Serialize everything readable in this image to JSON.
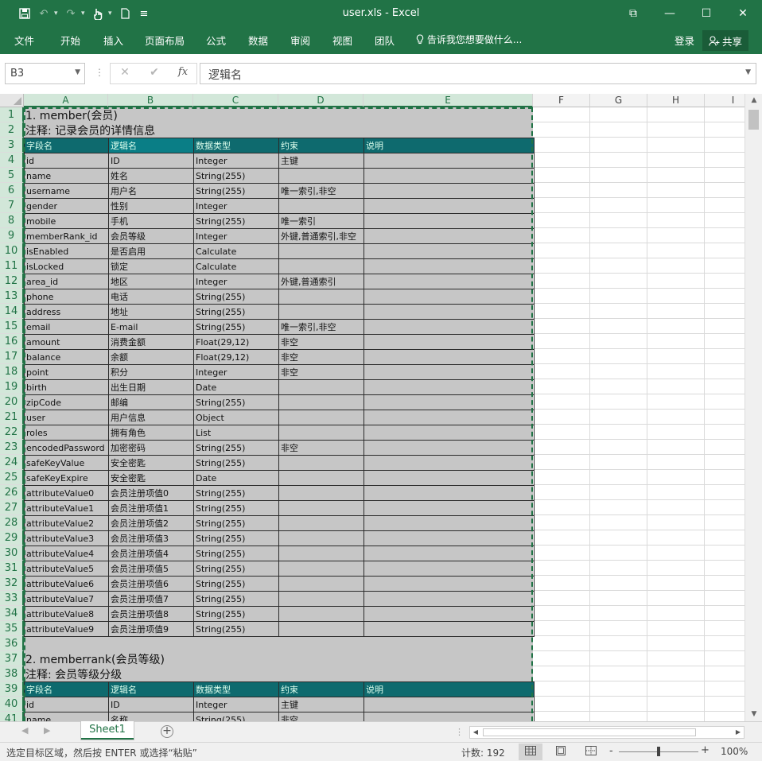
{
  "titlebar": {
    "title": "user.xls - Excel",
    "qat_more": "≡",
    "restore_glyph": "⧉",
    "min_glyph": "—",
    "max_glyph": "☐",
    "close_glyph": "✕"
  },
  "ribbon": {
    "tabs": [
      "文件",
      "开始",
      "插入",
      "页面布局",
      "公式",
      "数据",
      "审阅",
      "视图",
      "团队"
    ],
    "tell_me": "告诉我您想要做什么...",
    "login": "登录",
    "share": "共享"
  },
  "formula_bar": {
    "name_box": "B3",
    "cancel": "✕",
    "enter": "✔",
    "fx": "fx",
    "content": "逻辑名"
  },
  "columns": [
    "A",
    "B",
    "C",
    "D",
    "E",
    "F",
    "G",
    "H",
    "I"
  ],
  "rows": [
    "1",
    "2",
    "3",
    "4",
    "5",
    "6",
    "7",
    "8",
    "9",
    "10",
    "11",
    "12",
    "13",
    "14",
    "15",
    "16",
    "17",
    "18",
    "19",
    "20",
    "21",
    "22",
    "23",
    "24",
    "25",
    "26",
    "27",
    "28",
    "29",
    "30",
    "31",
    "32",
    "33",
    "34",
    "35",
    "36",
    "37",
    "38",
    "39",
    "40",
    "41"
  ],
  "sheet": {
    "section1_title": "1. member(会员)",
    "section1_note": "注释: 记录会员的详情信息",
    "section2_title": "2. memberrank(会员等级)",
    "section2_note": "注释: 会员等级分级",
    "header": [
      "字段名",
      "逻辑名",
      "数据类型",
      "约束",
      "说明"
    ],
    "table1": [
      [
        "id",
        "ID",
        "Integer",
        "主键",
        ""
      ],
      [
        "name",
        "姓名",
        "String(255)",
        "",
        ""
      ],
      [
        "username",
        "用户名",
        "String(255)",
        "唯一索引,非空",
        ""
      ],
      [
        "gender",
        "性别",
        "Integer",
        "",
        ""
      ],
      [
        "mobile",
        "手机",
        "String(255)",
        "唯一索引",
        ""
      ],
      [
        "memberRank_id",
        "会员等级",
        "Integer",
        "外键,普通索引,非空",
        ""
      ],
      [
        "isEnabled",
        "是否启用",
        "Calculate",
        "",
        ""
      ],
      [
        "isLocked",
        "锁定",
        "Calculate",
        "",
        ""
      ],
      [
        "area_id",
        "地区",
        "Integer",
        "外键,普通索引",
        ""
      ],
      [
        "phone",
        "电话",
        "String(255)",
        "",
        ""
      ],
      [
        "address",
        "地址",
        "String(255)",
        "",
        ""
      ],
      [
        "email",
        "E-mail",
        "String(255)",
        "唯一索引,非空",
        ""
      ],
      [
        "amount",
        "消费金额",
        "Float(29,12)",
        "非空",
        ""
      ],
      [
        "balance",
        "余额",
        "Float(29,12)",
        "非空",
        ""
      ],
      [
        "point",
        "积分",
        "Integer",
        "非空",
        ""
      ],
      [
        "birth",
        "出生日期",
        "Date",
        "",
        ""
      ],
      [
        "zipCode",
        "邮编",
        "String(255)",
        "",
        ""
      ],
      [
        "user",
        "用户信息",
        "Object",
        "",
        ""
      ],
      [
        "roles",
        "拥有角色",
        "List",
        "",
        ""
      ],
      [
        "encodedPassword",
        "加密密码",
        "String(255)",
        "非空",
        ""
      ],
      [
        "safeKeyValue",
        "安全密匙",
        "String(255)",
        "",
        ""
      ],
      [
        "safeKeyExpire",
        "安全密匙",
        "Date",
        "",
        ""
      ],
      [
        "attributeValue0",
        "会员注册项值0",
        "String(255)",
        "",
        ""
      ],
      [
        "attributeValue1",
        "会员注册项值1",
        "String(255)",
        "",
        ""
      ],
      [
        "attributeValue2",
        "会员注册项值2",
        "String(255)",
        "",
        ""
      ],
      [
        "attributeValue3",
        "会员注册项值3",
        "String(255)",
        "",
        ""
      ],
      [
        "attributeValue4",
        "会员注册项值4",
        "String(255)",
        "",
        ""
      ],
      [
        "attributeValue5",
        "会员注册项值5",
        "String(255)",
        "",
        ""
      ],
      [
        "attributeValue6",
        "会员注册项值6",
        "String(255)",
        "",
        ""
      ],
      [
        "attributeValue7",
        "会员注册项值7",
        "String(255)",
        "",
        ""
      ],
      [
        "attributeValue8",
        "会员注册项值8",
        "String(255)",
        "",
        ""
      ],
      [
        "attributeValue9",
        "会员注册项值9",
        "String(255)",
        "",
        ""
      ]
    ],
    "table2": [
      [
        "id",
        "ID",
        "Integer",
        "主键",
        ""
      ],
      [
        "name",
        "名称",
        "String(255)",
        "非空",
        ""
      ]
    ]
  },
  "sheet_tabs": {
    "active": "Sheet1",
    "add": "+"
  },
  "statusbar": {
    "message": "选定目标区域，然后按 ENTER 或选择“粘贴”",
    "count": "计数: 192",
    "zoom_minus": "-",
    "zoom_plus": "+",
    "zoom": "100%"
  },
  "colors": {
    "accent": "#217346",
    "header_fill": "#0e6a6e",
    "grey_fill": "#c6c6c6"
  }
}
